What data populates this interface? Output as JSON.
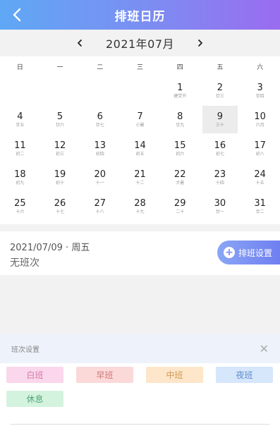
{
  "header": {
    "title": "排班日历"
  },
  "month": {
    "label": "2021年07月"
  },
  "weekdays": [
    "日",
    "一",
    "二",
    "三",
    "四",
    "五",
    "六"
  ],
  "weeks": [
    [
      {
        "d": "",
        "l": ""
      },
      {
        "d": "",
        "l": ""
      },
      {
        "d": "",
        "l": ""
      },
      {
        "d": "",
        "l": ""
      },
      {
        "d": "1",
        "l": "建党节"
      },
      {
        "d": "2",
        "l": "廿三"
      },
      {
        "d": "3",
        "l": "廿四"
      }
    ],
    [
      {
        "d": "4",
        "l": "廿五"
      },
      {
        "d": "5",
        "l": "廿六"
      },
      {
        "d": "6",
        "l": "廿七"
      },
      {
        "d": "7",
        "l": "小暑"
      },
      {
        "d": "8",
        "l": "廿九"
      },
      {
        "d": "9",
        "l": "三十",
        "selected": true
      },
      {
        "d": "10",
        "l": "六月"
      }
    ],
    [
      {
        "d": "11",
        "l": "初二"
      },
      {
        "d": "12",
        "l": "初三"
      },
      {
        "d": "13",
        "l": "初四"
      },
      {
        "d": "14",
        "l": "初五"
      },
      {
        "d": "15",
        "l": "初六"
      },
      {
        "d": "16",
        "l": "初七"
      },
      {
        "d": "17",
        "l": "初八"
      }
    ],
    [
      {
        "d": "18",
        "l": "初九"
      },
      {
        "d": "19",
        "l": "初十"
      },
      {
        "d": "20",
        "l": "十一"
      },
      {
        "d": "21",
        "l": "十二"
      },
      {
        "d": "22",
        "l": "大暑"
      },
      {
        "d": "23",
        "l": "十四"
      },
      {
        "d": "24",
        "l": "十五"
      }
    ],
    [
      {
        "d": "25",
        "l": "十六"
      },
      {
        "d": "26",
        "l": "十七"
      },
      {
        "d": "27",
        "l": "十八"
      },
      {
        "d": "28",
        "l": "十九"
      },
      {
        "d": "29",
        "l": "二十"
      },
      {
        "d": "30",
        "l": "廿一"
      },
      {
        "d": "31",
        "l": "廿二"
      }
    ]
  ],
  "selected_day": {
    "date": "2021/07/09 · 周五",
    "status": "无班次",
    "button_label": "排班设置"
  },
  "shift_panel": {
    "title": "班次设置",
    "close_icon": "close-icon",
    "shifts": [
      {
        "label": "白班",
        "bg": "#fbd7ec",
        "color": "#d27aa9"
      },
      {
        "label": "早班",
        "bg": "#fbd9d9",
        "color": "#d27676"
      },
      {
        "label": "中班",
        "bg": "#fde6c9",
        "color": "#d29a55"
      },
      {
        "label": "夜班",
        "bg": "#d6e6fb",
        "color": "#5f8dc9"
      },
      {
        "label": "休息",
        "bg": "#d4f3df",
        "color": "#4fa574"
      }
    ]
  }
}
